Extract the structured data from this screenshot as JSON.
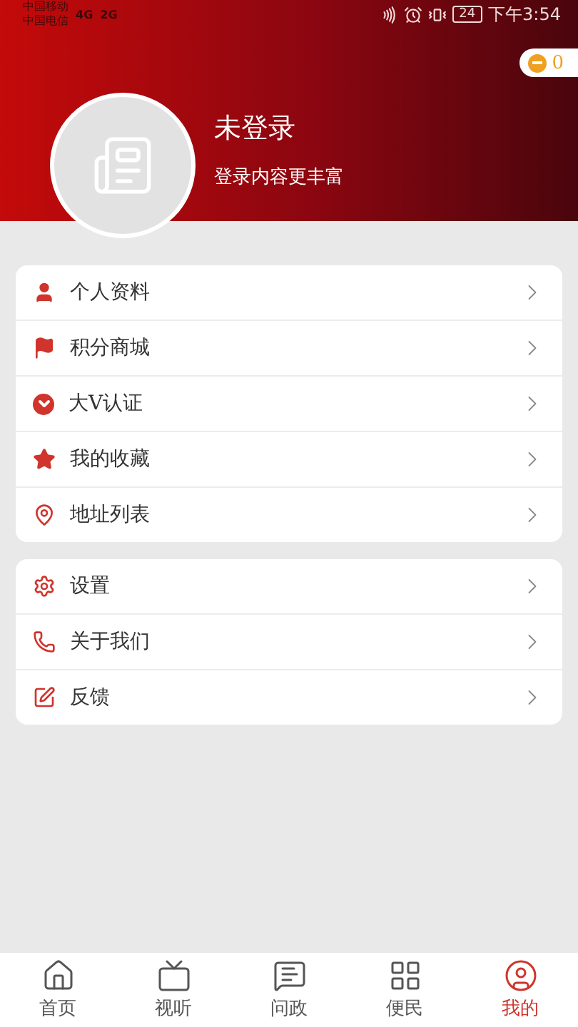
{
  "status_bar": {
    "carriers": [
      "中国移动",
      "中国电信"
    ],
    "networks": [
      "4G",
      "2G"
    ],
    "battery": "24",
    "time": "下午3:54"
  },
  "points": {
    "value": "0"
  },
  "profile": {
    "name": "未登录",
    "subtitle": "登录内容更丰富"
  },
  "menu_groups": [
    [
      {
        "kind": "person",
        "label": "个人资料"
      },
      {
        "kind": "flag",
        "label": "积分商城"
      },
      {
        "kind": "verify",
        "label": "大V认证"
      },
      {
        "kind": "star",
        "label": "我的收藏"
      },
      {
        "kind": "pin",
        "label": "地址列表"
      }
    ],
    [
      {
        "kind": "gear",
        "label": "设置"
      },
      {
        "kind": "phone",
        "label": "关于我们"
      },
      {
        "kind": "edit",
        "label": "反馈"
      }
    ]
  ],
  "bottom_nav": [
    {
      "kind": "home",
      "label": "首页",
      "selected": false
    },
    {
      "kind": "tv",
      "label": "视听",
      "selected": false
    },
    {
      "kind": "ask",
      "label": "问政",
      "selected": false
    },
    {
      "kind": "service",
      "label": "便民",
      "selected": false
    },
    {
      "kind": "me",
      "label": "我的",
      "selected": true
    }
  ]
}
